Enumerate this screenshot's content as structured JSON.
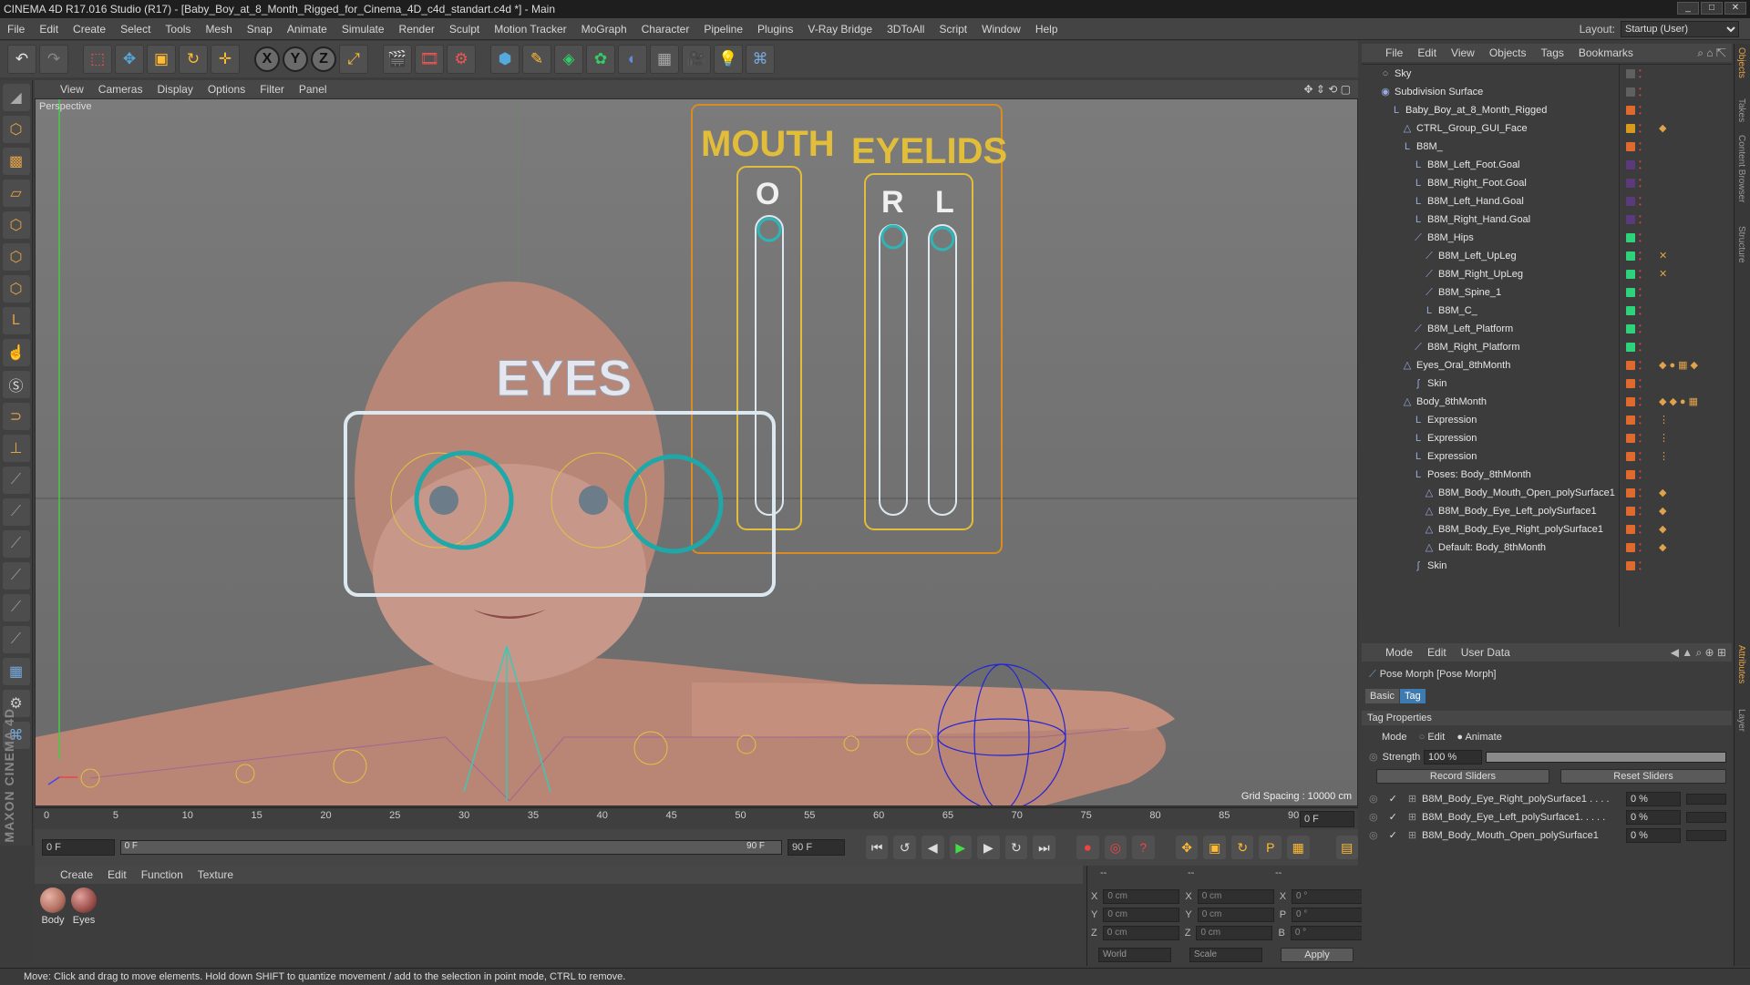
{
  "window": {
    "title": "CINEMA 4D R17.016 Studio (R17) - [Baby_Boy_at_8_Month_Rigged_for_Cinema_4D_c4d_standart.c4d *] - Main"
  },
  "menubar": {
    "items": [
      "File",
      "Edit",
      "Create",
      "Select",
      "Tools",
      "Mesh",
      "Snap",
      "Animate",
      "Simulate",
      "Render",
      "Sculpt",
      "Motion Tracker",
      "MoGraph",
      "Character",
      "Pipeline",
      "Plugins",
      "V-Ray Bridge",
      "3DToAll",
      "Script",
      "Window",
      "Help"
    ],
    "layout_label": "Layout:",
    "layout_value": "Startup (User)"
  },
  "viewport": {
    "menu": [
      "View",
      "Cameras",
      "Display",
      "Options",
      "Filter",
      "Panel"
    ],
    "label": "Perspective",
    "grid_spacing": "Grid Spacing : 10000 cm",
    "overlay": {
      "mouth": "MOUTH",
      "eyelids": "EYELIDS",
      "o": "O",
      "r": "R",
      "l": "L",
      "eyes": "EYES"
    }
  },
  "timeline": {
    "ticks": [
      "0",
      "5",
      "10",
      "15",
      "20",
      "25",
      "30",
      "35",
      "40",
      "45",
      "50",
      "55",
      "60",
      "65",
      "70",
      "75",
      "80",
      "85",
      "90"
    ],
    "current_frame": "0 F",
    "start_field": "0 F",
    "range_start": "0 F",
    "range_end": "90 F",
    "end_field": "90 F"
  },
  "material_panel": {
    "menu": [
      "Create",
      "Edit",
      "Function",
      "Texture"
    ],
    "materials": [
      {
        "name": "Body",
        "color": "#b06f60"
      },
      {
        "name": "Eyes",
        "color": "#9b4f4a"
      }
    ]
  },
  "coordinates": {
    "header_cols": [
      "--",
      "--",
      "--"
    ],
    "rows": [
      {
        "axis": "X",
        "pos": "0 cm",
        "axis2": "X",
        "size": "0 cm",
        "axis3": "X",
        "rot": "0 °"
      },
      {
        "axis": "Y",
        "pos": "0 cm",
        "axis2": "Y",
        "size": "0 cm",
        "axis3": "P",
        "rot": "0 °"
      },
      {
        "axis": "Z",
        "pos": "0 cm",
        "axis2": "Z",
        "size": "0 cm",
        "axis3": "B",
        "rot": "0 °"
      }
    ],
    "space": "World",
    "scale": "Scale",
    "apply": "Apply"
  },
  "status": "Move: Click and drag to move elements. Hold down SHIFT to quantize movement / add to the selection in point mode, CTRL to remove.",
  "objects": {
    "menu": [
      "File",
      "Edit",
      "View",
      "Objects",
      "Tags",
      "Bookmarks"
    ],
    "rows": [
      {
        "name": "Sky",
        "indent": 0,
        "icon": "○",
        "color": "#606060",
        "tags": ""
      },
      {
        "name": "Subdivision Surface",
        "indent": 0,
        "icon": "◉",
        "color": "#606060",
        "tags": ""
      },
      {
        "name": "Baby_Boy_at_8_Month_Rigged",
        "indent": 1,
        "icon": "L",
        "color": "#e06a2e",
        "tags": ""
      },
      {
        "name": "CTRL_Group_GUI_Face",
        "indent": 2,
        "icon": "△",
        "color": "#d89a1c",
        "tags": "◆"
      },
      {
        "name": "B8M_",
        "indent": 2,
        "icon": "L",
        "color": "#e06a2e",
        "tags": ""
      },
      {
        "name": "B8M_Left_Foot.Goal",
        "indent": 3,
        "icon": "L",
        "color": "#5a3a7a",
        "tags": ""
      },
      {
        "name": "B8M_Right_Foot.Goal",
        "indent": 3,
        "icon": "L",
        "color": "#5a3a7a",
        "tags": ""
      },
      {
        "name": "B8M_Left_Hand.Goal",
        "indent": 3,
        "icon": "L",
        "color": "#5a3a7a",
        "tags": ""
      },
      {
        "name": "B8M_Right_Hand.Goal",
        "indent": 3,
        "icon": "L",
        "color": "#5a3a7a",
        "tags": ""
      },
      {
        "name": "B8M_Hips",
        "indent": 3,
        "icon": "⟋",
        "color": "#2fd27a",
        "tags": ""
      },
      {
        "name": "B8M_Left_UpLeg",
        "indent": 4,
        "icon": "⟋",
        "color": "#2fd27a",
        "tags": "✕"
      },
      {
        "name": "B8M_Right_UpLeg",
        "indent": 4,
        "icon": "⟋",
        "color": "#2fd27a",
        "tags": "✕"
      },
      {
        "name": "B8M_Spine_1",
        "indent": 4,
        "icon": "⟋",
        "color": "#2fd27a",
        "tags": ""
      },
      {
        "name": "B8M_C_",
        "indent": 4,
        "icon": "L",
        "color": "#2fd27a",
        "tags": ""
      },
      {
        "name": "B8M_Left_Platform",
        "indent": 3,
        "icon": "⟋",
        "color": "#2fd27a",
        "tags": ""
      },
      {
        "name": "B8M_Right_Platform",
        "indent": 3,
        "icon": "⟋",
        "color": "#2fd27a",
        "tags": ""
      },
      {
        "name": "Eyes_Oral_8thMonth",
        "indent": 2,
        "icon": "△",
        "color": "#e06a2e",
        "tags": "◆●▦◆"
      },
      {
        "name": "Skin",
        "indent": 3,
        "icon": "ʃ",
        "color": "#e06a2e",
        "tags": ""
      },
      {
        "name": "Body_8thMonth",
        "indent": 2,
        "icon": "△",
        "color": "#e06a2e",
        "tags": "◆◆●▦"
      },
      {
        "name": "Expression",
        "indent": 3,
        "icon": "L",
        "color": "#e06a2e",
        "tags": "⋮"
      },
      {
        "name": "Expression",
        "indent": 3,
        "icon": "L",
        "color": "#e06a2e",
        "tags": "⋮"
      },
      {
        "name": "Expression",
        "indent": 3,
        "icon": "L",
        "color": "#e06a2e",
        "tags": "⋮"
      },
      {
        "name": "Poses: Body_8thMonth",
        "indent": 3,
        "icon": "L",
        "color": "#e06a2e",
        "tags": ""
      },
      {
        "name": "B8M_Body_Mouth_Open_polySurface1",
        "indent": 4,
        "icon": "△",
        "color": "#e06a2e",
        "tags": "◆"
      },
      {
        "name": "B8M_Body_Eye_Left_polySurface1",
        "indent": 4,
        "icon": "△",
        "color": "#e06a2e",
        "tags": "◆"
      },
      {
        "name": "B8M_Body_Eye_Right_polySurface1",
        "indent": 4,
        "icon": "△",
        "color": "#e06a2e",
        "tags": "◆"
      },
      {
        "name": "Default: Body_8thMonth",
        "indent": 4,
        "icon": "△",
        "color": "#e06a2e",
        "tags": "◆"
      },
      {
        "name": "Skin",
        "indent": 3,
        "icon": "ʃ",
        "color": "#e06a2e",
        "tags": ""
      }
    ]
  },
  "attributes": {
    "menu": [
      "Mode",
      "Edit",
      "User Data"
    ],
    "title": "Pose Morph [Pose Morph]",
    "tabs": [
      "Basic",
      "Tag"
    ],
    "section": "Tag Properties",
    "mode_label": "Mode",
    "mode_edit": "Edit",
    "mode_animate": "Animate",
    "strength_label": "Strength",
    "strength_value": "100 %",
    "strength_fraction": 1.0,
    "record_sliders": "Record Sliders",
    "reset_sliders": "Reset Sliders",
    "sliders": [
      {
        "name": "B8M_Body_Eye_Right_polySurface1 . . . .",
        "value": "0 %"
      },
      {
        "name": "B8M_Body_Eye_Left_polySurface1. . . . .",
        "value": "0 %"
      },
      {
        "name": "B8M_Body_Mouth_Open_polySurface1",
        "value": "0 %"
      }
    ]
  },
  "right_strip": [
    "Objects",
    "Takes",
    "Content Browser",
    "Structure",
    "Attributes",
    "Layer"
  ]
}
